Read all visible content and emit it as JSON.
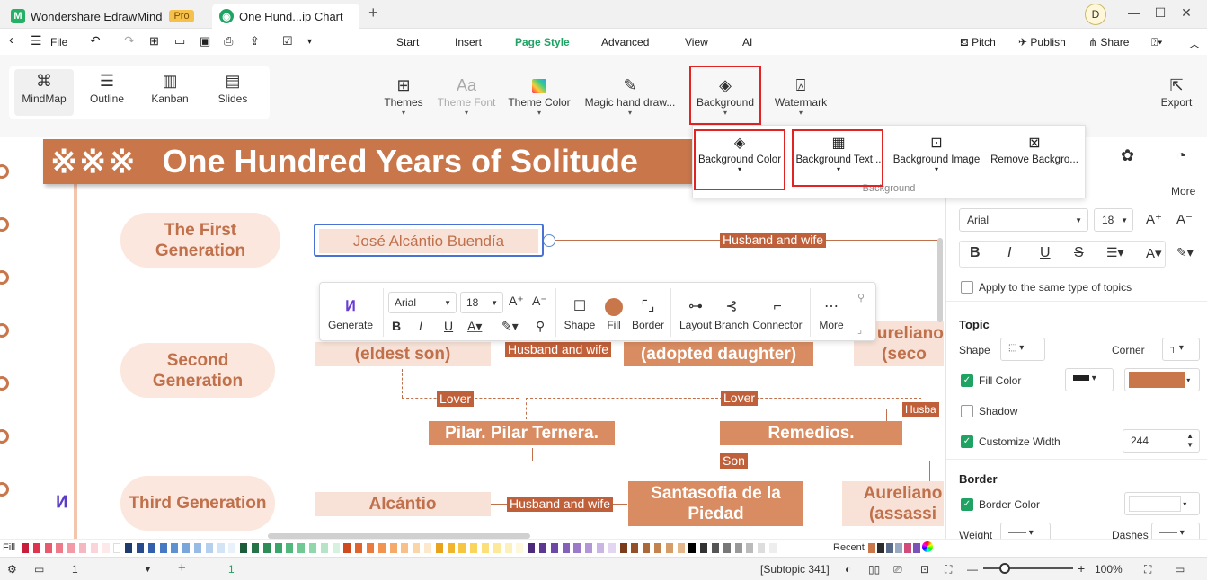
{
  "titlebar": {
    "app_tab": "Wondershare EdrawMind",
    "pro_badge": "Pro",
    "doc_tab": "One Hund...ip Chart",
    "new_tab": "+",
    "avatar": "D",
    "minimize": "—",
    "maximize": "☐",
    "close": "✕"
  },
  "menubar": {
    "file": "File",
    "items": [
      "Start",
      "Insert",
      "Page Style",
      "Advanced",
      "View",
      "AI"
    ],
    "active": "Page Style",
    "pitch": "Pitch",
    "publish": "Publish",
    "share": "Share"
  },
  "toolbar": {
    "views": [
      "MindMap",
      "Outline",
      "Kanban",
      "Slides"
    ],
    "themes": "Themes",
    "theme_font": "Theme Font",
    "theme_color": "Theme Color",
    "magic": "Magic hand draw...",
    "background": "Background",
    "watermark": "Watermark",
    "export": "Export"
  },
  "dropdown": {
    "items": [
      "Background Color",
      "Background Text...",
      "Background Image",
      "Remove Backgro..."
    ],
    "group_label": "Background"
  },
  "canvas": {
    "title": "One Hundred Years of Solitude",
    "title_deco": "※※※",
    "generations": [
      "The First Generation",
      "Second Generation",
      "Third Generation"
    ],
    "nodes": {
      "jose": "José Alcántio Buendía",
      "eldest": "(eldest son)",
      "adopted": "(adopted daughter)",
      "aureliano2": "Aureliano (seco",
      "pilar": "Pilar. Pilar Ternera.",
      "remedios": "Remedios.",
      "alcantio": "Alcántio",
      "santasofia": "Santasofia de la Piedad",
      "aureliano3": "Aureliano (assassi"
    },
    "relations": {
      "husband_wife_1": "Husband and wife",
      "husband_wife_2": "Husband and wife",
      "lover_1": "Lover",
      "lover_2": "Lover",
      "husba": "Husba",
      "son": "Son",
      "husband_wife_3": "Husband and wife"
    }
  },
  "floating_toolbar": {
    "generate": "Generate",
    "font": "Arial",
    "size": "18",
    "shape": "Shape",
    "fill": "Fill",
    "border": "Border",
    "layout": "Layout",
    "branch": "Branch",
    "connector": "Connector",
    "more": "More"
  },
  "right_panel": {
    "more": "More",
    "font": "Arial",
    "size": "18",
    "apply_same": "Apply to the same type of topics",
    "topic": "Topic",
    "shape": "Shape",
    "corner": "Corner",
    "fill_color": "Fill Color",
    "shadow": "Shadow",
    "customize_width": "Customize Width",
    "width_value": "244",
    "border": "Border",
    "border_color": "Border Color",
    "weight": "Weight",
    "dashes": "Dashes",
    "fill_swatch": "#c8764a"
  },
  "palette": {
    "fill_label": "Fill",
    "recent_label": "Recent"
  },
  "statusbar": {
    "page": "1",
    "add": "+",
    "page_tab": "1",
    "subtopic": "[Subtopic 341]",
    "zoom_minus": "—",
    "zoom_plus": "+",
    "zoom": "100%"
  }
}
